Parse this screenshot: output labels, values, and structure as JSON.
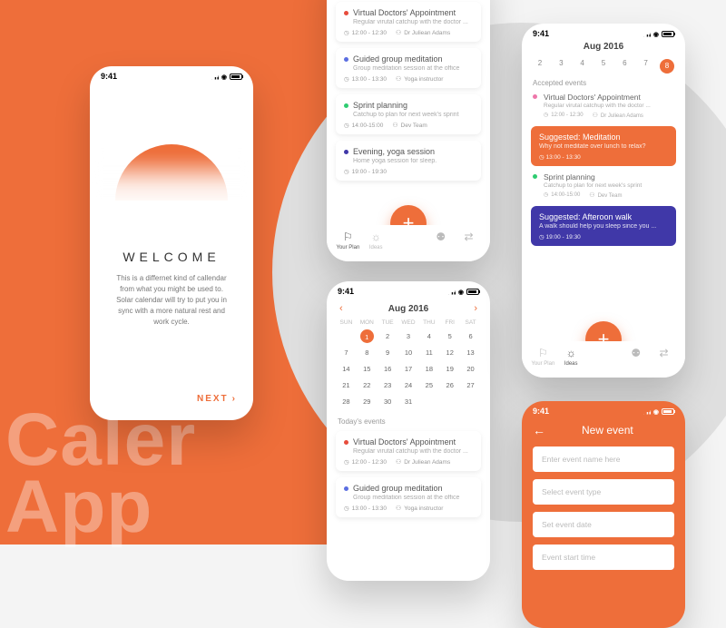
{
  "bg_text": "Caler\nApp",
  "status_time": "9:41",
  "welcome": {
    "title": "WELCOME",
    "body": "This is a differnet kind of callendar from what you might be used to. Solar calendar will try to put you in sync with a more natural rest and work cycle.",
    "next": "NEXT"
  },
  "colors": {
    "accent": "#ee6e3a",
    "purple": "#4038a8",
    "red": "#e74c3c",
    "green": "#2ecc71",
    "blue": "#5b6ee1",
    "violet": "#7b5bd6"
  },
  "events": [
    {
      "title": "Virtual Doctors' Appointment",
      "sub": "Regular virutal catchup with the doctor ...",
      "time": "12:00 - 12:30",
      "who": "Dr Juliean Adams",
      "dot": "#e74c3c"
    },
    {
      "title": "Guided group meditation",
      "sub": "Group meditation session at the office",
      "time": "13:00 - 13:30",
      "who": "Yoga instructor",
      "dot": "#5b6ee1"
    },
    {
      "title": "Sprint planning",
      "sub": "Catchup to plan for next week's sprint",
      "time": "14:00-15:00",
      "who": "Dev Team",
      "dot": "#2ecc71"
    },
    {
      "title": "Evening, yoga session",
      "sub": "Home yoga session for sleep.",
      "time": "19:00 - 19:30",
      "who": "",
      "dot": "#4038a8"
    }
  ],
  "nav": [
    {
      "icon": "⚐",
      "label": "Your Plan"
    },
    {
      "icon": "☼",
      "label": "Ideas"
    },
    {
      "icon": "",
      "label": ""
    },
    {
      "icon": "⚉",
      "label": ""
    },
    {
      "icon": "⇄",
      "label": ""
    }
  ],
  "calendar": {
    "month": "Aug 2016",
    "dow": [
      "SUN",
      "MON",
      "TUE",
      "WED",
      "THU",
      "FRI",
      "SAT"
    ],
    "leading_mute": 1,
    "days": 31,
    "selected": 1,
    "today_label": "Today's events"
  },
  "week": {
    "month": "Aug 2016",
    "days": [
      "2",
      "3",
      "4",
      "5",
      "6",
      "7",
      "8"
    ],
    "selected": "8",
    "accepted_label": "Accepted events"
  },
  "accepted": [
    {
      "title": "Virtual Doctors' Appointment",
      "sub": "Regular virutal catchup with the doctor ...",
      "time": "12:00 - 12:30",
      "who": "Dr Juliean Adams",
      "dot": "#e7a"
    },
    {
      "title": "Sprint planning",
      "sub": "Catchup to plan for next week's sprint",
      "time": "14:00-15:00",
      "who": "Dev Team",
      "dot": "#2ecc71"
    }
  ],
  "suggested": [
    {
      "title": "Suggested: Meditation",
      "sub": "Why not meditate over lunch to relax?",
      "time": "13:00 - 13:30",
      "style": "orange"
    },
    {
      "title": "Suggested: Afteroon walk",
      "sub": "A walk should help you sleep since you ...",
      "time": "19:00 - 19:30",
      "style": "purple"
    }
  ],
  "new_event": {
    "title": "New event",
    "fields": [
      "Enter event name here",
      "Select event type",
      "Set event date",
      "Event start time"
    ]
  }
}
